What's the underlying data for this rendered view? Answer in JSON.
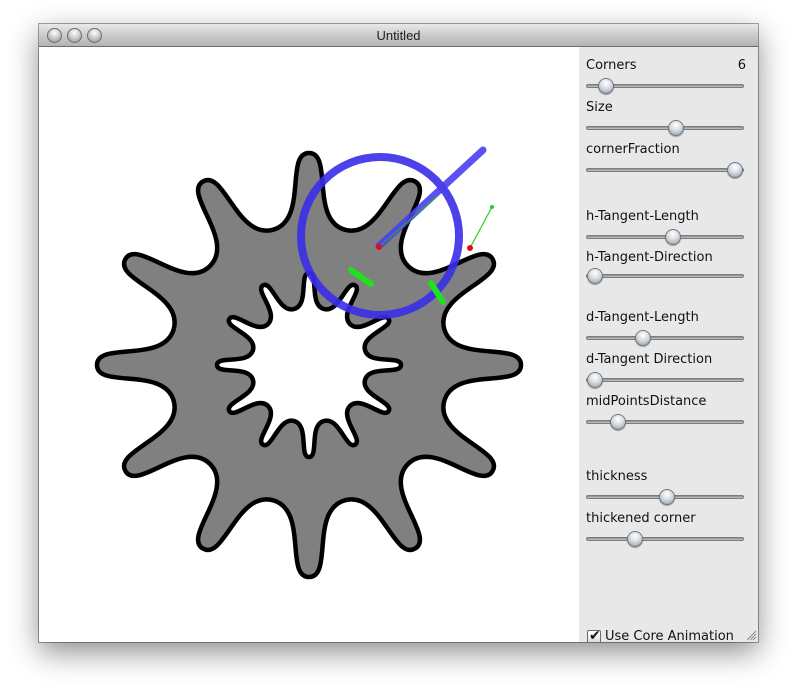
{
  "window": {
    "title": "Untitled"
  },
  "controls": {
    "corners": {
      "label": "Corners",
      "value": "6",
      "level": 0.12
    },
    "size": {
      "label": "Size",
      "level": 0.57
    },
    "corner_fraction": {
      "label": "cornerFraction",
      "level": 0.95
    },
    "h_tangent_length": {
      "label": "h-Tangent-Length",
      "level": 0.55
    },
    "h_tangent_direction": {
      "label": "h-Tangent-Direction",
      "level": 0.05
    },
    "d_tangent_length": {
      "label": "d-Tangent-Length",
      "level": 0.36
    },
    "d_tangent_direction": {
      "label": "d-Tangent Direction",
      "level": 0.05
    },
    "mid_points_distance": {
      "label": "midPointsDistance",
      "level": 0.2
    },
    "thickness": {
      "label": "thickness",
      "level": 0.51
    },
    "thickened_corner": {
      "label": "thickened corner",
      "level": 0.31
    },
    "use_core_animation": {
      "label": "Use Core Animation",
      "checked": true
    }
  },
  "colors": {
    "shape_fill": "#808080",
    "handle_blue": "#4a3ef0",
    "handle_green": "#20e020",
    "point_red": "#e01010"
  }
}
